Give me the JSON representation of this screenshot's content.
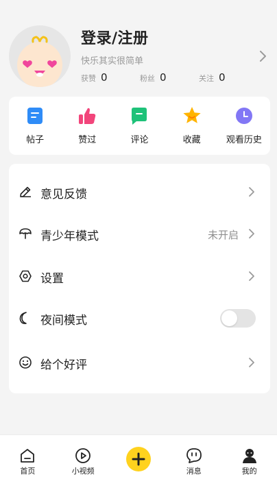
{
  "profile": {
    "title": "登录/注册",
    "subtitle": "快乐其实很简单",
    "stats": [
      {
        "label": "获赞",
        "value": "0"
      },
      {
        "label": "粉丝",
        "value": "0"
      },
      {
        "label": "关注",
        "value": "0"
      }
    ]
  },
  "quick_actions": [
    {
      "label": "帖子",
      "icon": "post-icon",
      "color": "#2f8cf7"
    },
    {
      "label": "赞过",
      "icon": "thumbs-up-icon",
      "color": "#f2457b"
    },
    {
      "label": "评论",
      "icon": "comment-icon",
      "color": "#1ec279"
    },
    {
      "label": "收藏",
      "icon": "star-icon",
      "color": "#ffb400"
    },
    {
      "label": "观看历史",
      "icon": "clock-icon",
      "color": "#8277f5"
    }
  ],
  "menu": {
    "feedback": {
      "label": "意见反馈",
      "icon": "pencil-icon"
    },
    "teen_mode": {
      "label": "青少年模式",
      "value": "未开启",
      "icon": "umbrella-icon"
    },
    "settings": {
      "label": "设置",
      "icon": "gear-icon"
    },
    "night_mode": {
      "label": "夜间模式",
      "icon": "moon-icon",
      "enabled": false
    },
    "rate": {
      "label": "给个好评",
      "icon": "smiley-icon"
    }
  },
  "tabbar": {
    "home": "首页",
    "video": "小视频",
    "messages": "消息",
    "mine": "我的"
  },
  "colors": {
    "accent": "#ffd21e",
    "background": "#f4f4f4"
  }
}
